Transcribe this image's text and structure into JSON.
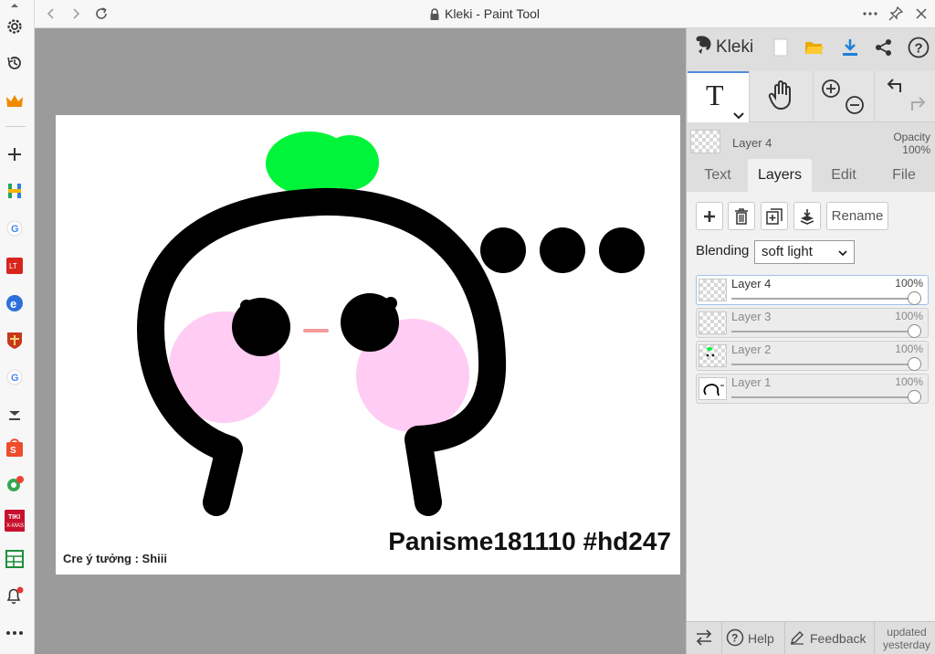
{
  "window": {
    "title": "Kleki - Paint Tool"
  },
  "drawing": {
    "watermark": "Panisme181110 #hd247",
    "credit": "Cre ý tưởng : Shiii"
  },
  "panel": {
    "logo_text": "Kleki",
    "current_layer": {
      "name": "Layer 4",
      "opacity_label": "Opacity",
      "opacity_value": "100%"
    },
    "tabs": [
      {
        "label": "Text",
        "active": false
      },
      {
        "label": "Layers",
        "active": true
      },
      {
        "label": "Edit",
        "active": false
      },
      {
        "label": "File",
        "active": false
      }
    ],
    "rename_label": "Rename",
    "blending_label": "Blending",
    "blending_value": "soft light",
    "layers": [
      {
        "name": "Layer 4",
        "opacity": "100%",
        "opacity_fraction": 1.0,
        "active": true
      },
      {
        "name": "Layer 3",
        "opacity": "100%",
        "opacity_fraction": 1.0,
        "active": false
      },
      {
        "name": "Layer 2",
        "opacity": "100%",
        "opacity_fraction": 1.0,
        "active": false
      },
      {
        "name": "Layer 1",
        "opacity": "100%",
        "opacity_fraction": 1.0,
        "active": false
      }
    ],
    "bottom": {
      "help_label": "Help",
      "feedback_label": "Feedback",
      "updated_line1": "updated",
      "updated_line2": "yesterday"
    }
  },
  "colors": {
    "accent": "#4d8bd8",
    "sprout": "#00f53a",
    "blush": "#ffccf3",
    "ink": "#000000"
  },
  "sidebar_icons": [
    "up-arrow-icon",
    "gear-icon",
    "history-icon",
    "crown-icon",
    "plus-icon",
    "h-app-icon",
    "google-icon",
    "lt-app-icon",
    "e-app-icon",
    "shield-app-icon",
    "google-icon",
    "download-icon",
    "shopee-icon",
    "map-pin-icon",
    "tiki-icon",
    "sheet-icon",
    "bell-icon",
    "more-icon"
  ]
}
